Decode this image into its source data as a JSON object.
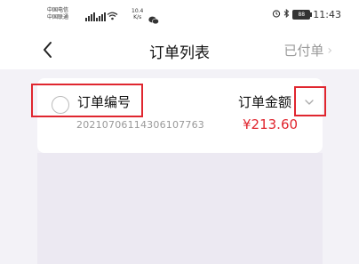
{
  "status_bar": {
    "carrier_1": "中国电信",
    "carrier_2": "中国联通",
    "net_speed_value": "10.4",
    "net_speed_unit": "K/s",
    "battery": "88",
    "time": "11:43",
    "icons": [
      "signal-icon",
      "wifi-icon",
      "wechat-icon",
      "alarm-icon",
      "bluetooth-icon",
      "battery-icon"
    ]
  },
  "navbar": {
    "title": "订单列表",
    "right_label": "已付单"
  },
  "order": {
    "number_label": "订单编号",
    "number_value": "20210706114306107763",
    "amount_label": "订单金额",
    "amount_value": "¥213.60"
  },
  "colors": {
    "accent": "#e0262f",
    "highlight_box": "#e0262f",
    "page_bg": "#f3f2f7"
  }
}
